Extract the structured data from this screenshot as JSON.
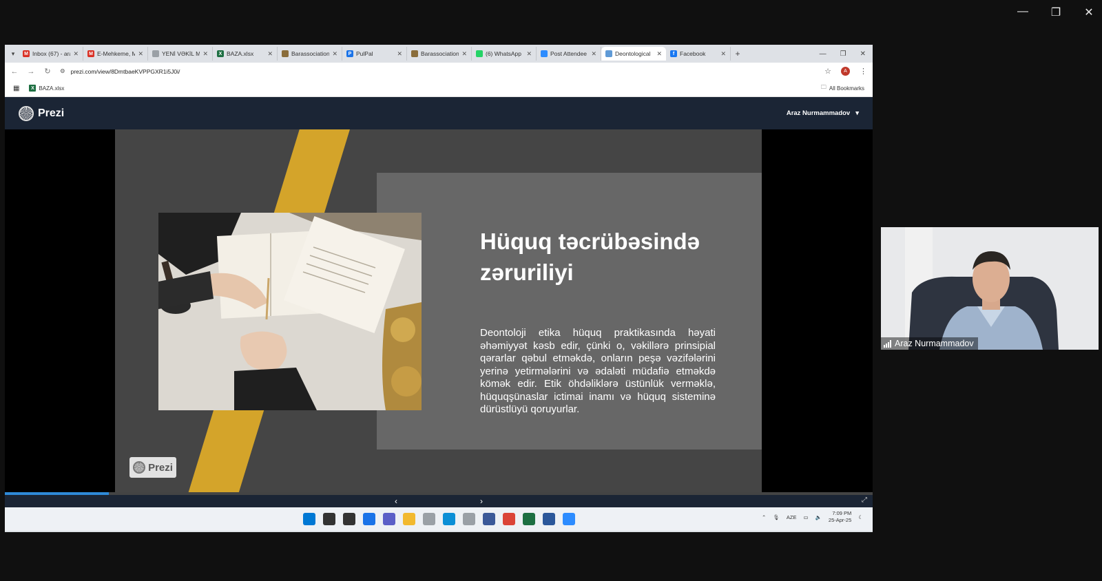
{
  "outer_window": {
    "minimize_glyph": "—",
    "restore_glyph": "❐",
    "close_glyph": "✕"
  },
  "browser": {
    "tabs": [
      {
        "label": "Inbox (67) - ara",
        "icon": "gmail-icon",
        "color": "#d93025",
        "glyph": "M"
      },
      {
        "label": "E-Mehkeme, M",
        "icon": "gmail-icon",
        "color": "#d93025",
        "glyph": "M"
      },
      {
        "label": "YENİ VƏKİL MÜ",
        "icon": "document-icon",
        "color": "#9aa0a6",
        "glyph": ""
      },
      {
        "label": "BAZA.xlsx",
        "icon": "excel-icon",
        "color": "#1d6f42",
        "glyph": "X"
      },
      {
        "label": "Barassociation",
        "icon": "bar-association-icon",
        "color": "#8a6d3b",
        "glyph": ""
      },
      {
        "label": "PulPal",
        "icon": "pulpal-icon",
        "color": "#1a73e8",
        "glyph": "P"
      },
      {
        "label": "Barassociation",
        "icon": "bar-association-icon",
        "color": "#8a6d3b",
        "glyph": ""
      },
      {
        "label": "(6) WhatsApp",
        "icon": "whatsapp-icon",
        "color": "#25d366",
        "glyph": ""
      },
      {
        "label": "Post Attendee",
        "icon": "zoom-icon",
        "color": "#2d8cff",
        "glyph": ""
      },
      {
        "label": "Deontological",
        "icon": "globe-icon",
        "color": "#5f9ad6",
        "glyph": ""
      },
      {
        "label": "Facebook",
        "icon": "facebook-icon",
        "color": "#1877f2",
        "glyph": "f"
      }
    ],
    "active_tab_index": 9,
    "new_tab_glyph": "+",
    "url": "prezi.com/view/8DmtbaeKVPPGXR1i5J0i/",
    "profile_initial": "A",
    "bookmarks": [
      {
        "label": "BAZA.xlsx"
      }
    ],
    "all_bookmarks_label": "All Bookmarks"
  },
  "prezi": {
    "brand": "Prezi",
    "user_name": "Araz Nurmammadov",
    "slide": {
      "title": "Hüquq təcrübəsində zəruriliyi",
      "body": "Deontoloji etika hüquq praktikasında həyati əhəmiyyət kəsb edir, çünki o, vəkillərə prinsipial qərarlar qəbul etməkdə, onların peşə vəzifələrini yerinə yetirmələrini və ədaləti müdafiə etməkdə kömək edir. Etik öhdəliklərə üstünlük verməklə, hüquqşünaslar ictimai inamı və hüquq sisteminə dürüstlüyü qoruyurlar.",
      "badge": "Prezi"
    },
    "progress_fraction": 0.12,
    "prev_glyph": "‹",
    "next_glyph": "›",
    "fullscreen_glyph": "⤢"
  },
  "taskbar": {
    "icons": [
      {
        "name": "windows-start-icon",
        "color": "#0078d4"
      },
      {
        "name": "search-icon",
        "color": "#333333"
      },
      {
        "name": "task-view-icon",
        "color": "#333333"
      },
      {
        "name": "widgets-icon",
        "color": "#1a73e8"
      },
      {
        "name": "teams-icon",
        "color": "#5b5fc7"
      },
      {
        "name": "file-explorer-icon",
        "color": "#f2b92f"
      },
      {
        "name": "app-icon",
        "color": "#9aa0a6"
      },
      {
        "name": "edge-icon",
        "color": "#0c8fd6"
      },
      {
        "name": "app2-icon",
        "color": "#9aa0a6"
      },
      {
        "name": "app3-icon",
        "color": "#3b5998"
      },
      {
        "name": "chrome-icon",
        "color": "#db4437"
      },
      {
        "name": "excel-icon",
        "color": "#1d6f42"
      },
      {
        "name": "word-icon",
        "color": "#2b579a"
      },
      {
        "name": "zoom-icon",
        "color": "#2d8cff"
      }
    ],
    "language": "AZE",
    "time": "7:09 PM",
    "date": "25-Apr-25"
  },
  "webcam": {
    "participant_name": "Araz Nurmammadov"
  }
}
